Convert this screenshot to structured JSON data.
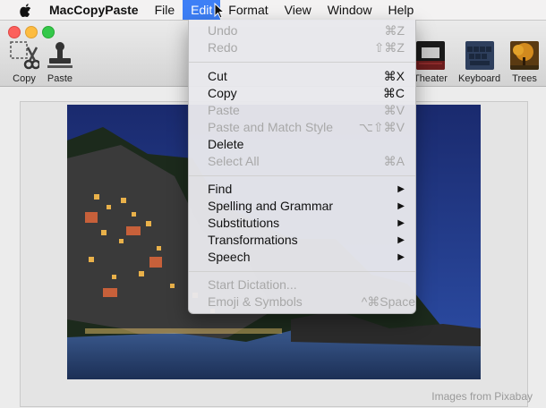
{
  "menubar": {
    "app_name": "MacCopyPaste",
    "menus": [
      "File",
      "Edit",
      "Format",
      "View",
      "Window",
      "Help"
    ]
  },
  "toolbar": {
    "copy_label": "Copy",
    "paste_label": "Paste",
    "theater_label": "Theater",
    "keyboard_label": "Keyboard",
    "trees_label": "Trees"
  },
  "edit_menu": {
    "undo": {
      "label": "Undo",
      "shortcut": "⌘Z"
    },
    "redo": {
      "label": "Redo",
      "shortcut": "⇧⌘Z"
    },
    "cut": {
      "label": "Cut",
      "shortcut": "⌘X"
    },
    "copy": {
      "label": "Copy",
      "shortcut": "⌘C"
    },
    "paste": {
      "label": "Paste",
      "shortcut": "⌘V"
    },
    "paste_match": {
      "label": "Paste and Match Style",
      "shortcut": "⌥⇧⌘V"
    },
    "delete": {
      "label": "Delete"
    },
    "select_all": {
      "label": "Select All",
      "shortcut": "⌘A"
    },
    "find": {
      "label": "Find"
    },
    "spelling": {
      "label": "Spelling and Grammar"
    },
    "substitutions": {
      "label": "Substitutions"
    },
    "transformations": {
      "label": "Transformations"
    },
    "speech": {
      "label": "Speech"
    },
    "dictation": {
      "label": "Start Dictation..."
    },
    "emoji": {
      "label": "Emoji & Symbols",
      "shortcut": "^⌘Space"
    }
  },
  "credit": "Images from Pixabay",
  "colors": {
    "accent": "#3d7ff6"
  }
}
